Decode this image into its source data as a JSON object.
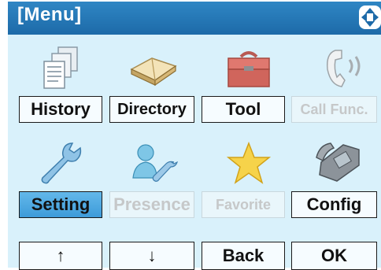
{
  "header": {
    "title": "[Menu]",
    "nav_icon": "four-way-arrow-icon"
  },
  "menu": {
    "items": [
      {
        "label": "History",
        "icon": "history-documents-icon",
        "state": "normal"
      },
      {
        "label": "Directory",
        "icon": "directory-book-icon",
        "state": "normal"
      },
      {
        "label": "Tool",
        "icon": "toolbox-icon",
        "state": "normal"
      },
      {
        "label": "Call Func.",
        "icon": "call-function-handset-icon",
        "state": "disabled"
      },
      {
        "label": "Setting",
        "icon": "wrench-icon",
        "state": "selected"
      },
      {
        "label": "Presence",
        "icon": "presence-people-wrench-icon",
        "state": "disabled"
      },
      {
        "label": "Favorite",
        "icon": "star-icon",
        "state": "disabled"
      },
      {
        "label": "Config",
        "icon": "desk-phone-icon",
        "state": "normal"
      }
    ]
  },
  "softkeys": {
    "up": "↑",
    "down": "↓",
    "back": "Back",
    "ok": "OK"
  },
  "colors": {
    "titlebar": "#2277b8",
    "background": "#d9f1fb",
    "selected": "#4aa8e0",
    "disabled_text": "#c6c8c9"
  }
}
